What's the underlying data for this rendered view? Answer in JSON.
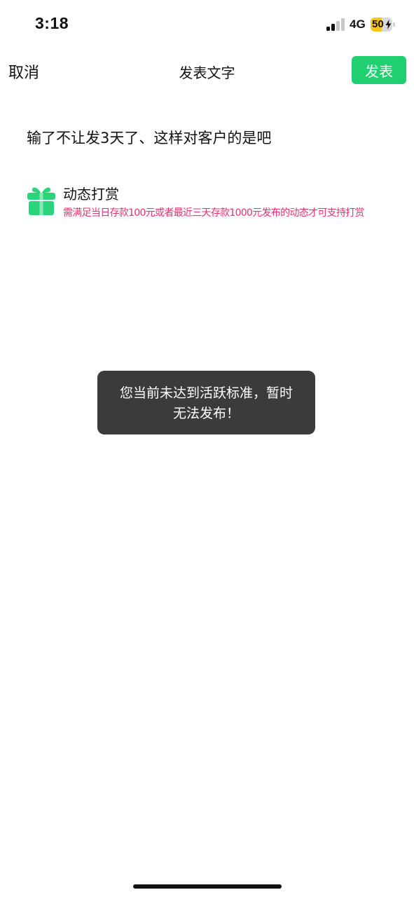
{
  "status_bar": {
    "time": "3:18",
    "network": "4G",
    "battery_level": "50",
    "battery_fill_fraction": 0.5,
    "battery_color": "#f5c518",
    "signal_bars_active": 2,
    "signal_bars_total": 4
  },
  "nav": {
    "cancel_label": "取消",
    "title": "发表文字",
    "publish_label": "发表"
  },
  "post": {
    "text": "输了不让发3天了、这样对客户的是吧"
  },
  "reward": {
    "icon": "gift-icon",
    "title": "动态打赏",
    "note": "需满足当日存款100元或者最近三天存款1000元发布的动态才可支持打赏"
  },
  "toast": {
    "line1": "您当前未达到活跃标准，暂时",
    "line2": "无法发布！"
  },
  "colors": {
    "accent": "#1fcf70",
    "gift": "#2ad47a",
    "note": "#e8336d",
    "toast_bg": "#3b3b3b",
    "signal_active": "#111111",
    "signal_inactive": "#c8c8c8"
  }
}
